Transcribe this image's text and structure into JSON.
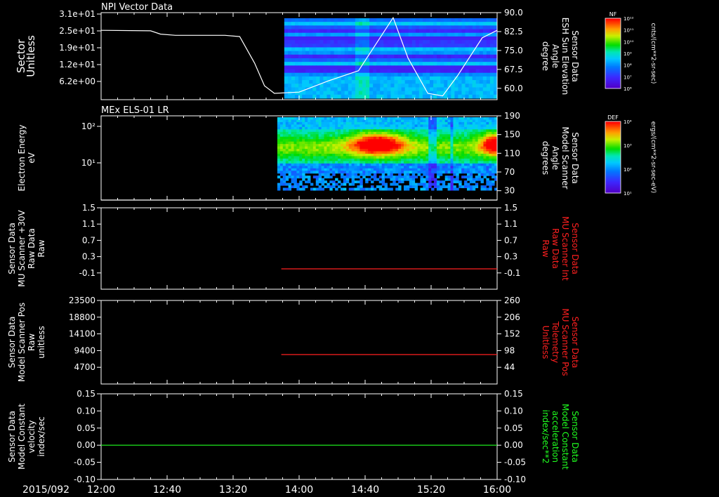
{
  "date_label": "2015/092",
  "x_ticks": [
    "12:00",
    "12:40",
    "13:20",
    "14:00",
    "14:40",
    "15:20",
    "16:00"
  ],
  "chart_data": [
    {
      "type": "heatmap",
      "title": "NPI Vector Data",
      "left_axis": {
        "label": [
          "Sector",
          "Unitless"
        ],
        "ticks": [
          "3.1e+01",
          "2.5e+01",
          "1.9e+01",
          "1.2e+01",
          "6.2e+00"
        ]
      },
      "right_axis": {
        "label": [
          "Sensor Data",
          "ESH Sun Elevation",
          "Angle",
          "degree"
        ],
        "ticks": [
          "90.0",
          "82.5",
          "75.0",
          "67.5",
          "60.0"
        ],
        "ylim": [
          55.5,
          90
        ]
      },
      "colorbar": {
        "title": "NF",
        "unit": "cnts/(cm**2-sr-sec)",
        "ticks": [
          "10¹²",
          "10¹¹",
          "10¹⁰",
          "10⁹",
          "10⁸",
          "10⁷",
          "10⁶"
        ]
      },
      "line_series": {
        "name": "ESH Sun Elevation Angle",
        "color": "#ffffff",
        "x_hours": [
          12.0,
          12.5,
          12.6,
          12.75,
          13.0,
          13.25,
          13.4,
          13.55,
          13.65,
          13.75,
          14.0,
          14.3,
          14.6,
          14.75,
          14.95,
          15.1,
          15.3,
          15.45,
          15.6,
          15.85,
          16.0
        ],
        "y": [
          83.0,
          82.8,
          81.5,
          81.0,
          81.0,
          81.0,
          80.5,
          70.0,
          61.0,
          58.0,
          58.5,
          63.0,
          67.0,
          76.0,
          88.0,
          72.0,
          58.0,
          57.0,
          65.0,
          80.0,
          83.0
        ]
      }
    },
    {
      "type": "heatmap",
      "title": "MEx ELS-01 LR",
      "left_axis": {
        "label": [
          "Electron Energy",
          "eV"
        ],
        "ticks": [
          "10²",
          "10¹"
        ]
      },
      "right_axis": {
        "label": [
          "Sensor Data",
          "Model Scanner",
          "Angle",
          "degrees"
        ],
        "ticks": [
          "190",
          "150",
          "110",
          "70",
          "30"
        ],
        "ylim": [
          10,
          190
        ]
      },
      "colorbar": {
        "title": "DEF",
        "unit": "ergs/(cm**2-sr-sec-eV)",
        "ticks": [
          "10⁴",
          "10³",
          "10²",
          "10¹"
        ]
      },
      "line_series": {
        "name": "Model Scanner Angle",
        "color": "#ffffff",
        "x_hours": [
          12.0,
          16.0
        ],
        "y": [
          10.0,
          10.0
        ]
      }
    },
    {
      "type": "line",
      "left_axis": {
        "label": [
          "Sensor Data",
          "MU Scanner +30V",
          "Raw Data",
          "Raw"
        ],
        "ticks": [
          "1.5",
          "1.1",
          "0.7",
          "0.3",
          "-0.1"
        ],
        "ylim": [
          -0.5,
          1.5
        ]
      },
      "right_axis": {
        "label": [
          "Sensor Data",
          "MU Scanner Int",
          "Raw Data",
          "Raw"
        ],
        "ticks": [
          "1.5",
          "1.1",
          "0.7",
          "0.3",
          "-0.1"
        ],
        "ylim": [
          -0.5,
          1.5
        ],
        "color": "#ff2020"
      },
      "series": [
        {
          "color": "#ff2020",
          "x_hours": [
            13.82,
            16.0
          ],
          "y": [
            0.0,
            0.0
          ]
        }
      ]
    },
    {
      "type": "line",
      "left_axis": {
        "label": [
          "Sensor Data",
          "Model Scanner Pos",
          "Raw",
          "unitless"
        ],
        "ticks": [
          "23500",
          "18800",
          "14100",
          "9400",
          "4700"
        ],
        "ylim": [
          0,
          23500
        ]
      },
      "right_axis": {
        "label": [
          "Sensor Data",
          "MU Scanner Pos",
          "Telemetry",
          "Unitless"
        ],
        "ticks": [
          "260",
          "206",
          "152",
          "98",
          "44"
        ],
        "ylim": [
          -10,
          260
        ],
        "color": "#ff2020"
      },
      "series": [
        {
          "color": "#ff2020",
          "x_hours": [
            13.82,
            16.0
          ],
          "y": [
            85,
            85
          ]
        }
      ]
    },
    {
      "type": "line",
      "left_axis": {
        "label": [
          "Sensor Data",
          "Model Constant",
          "velocity",
          "index/sec"
        ],
        "ticks": [
          "0.15",
          "0.10",
          "0.05",
          "0.00",
          "-0.05",
          "-0.10"
        ],
        "ylim": [
          -0.1,
          0.15
        ]
      },
      "right_axis": {
        "label": [
          "Sensor Data",
          "Model Constant",
          "acceleration",
          "index/sec**2"
        ],
        "ticks": [
          "0.15",
          "0.10",
          "0.05",
          "0.00",
          "-0.05",
          "-0.10"
        ],
        "ylim": [
          -0.1,
          0.15
        ],
        "color": "#20ff20"
      },
      "series": [
        {
          "color": "#20ff20",
          "x_hours": [
            12.0,
            16.0
          ],
          "y": [
            0.0,
            0.0
          ]
        }
      ]
    }
  ]
}
